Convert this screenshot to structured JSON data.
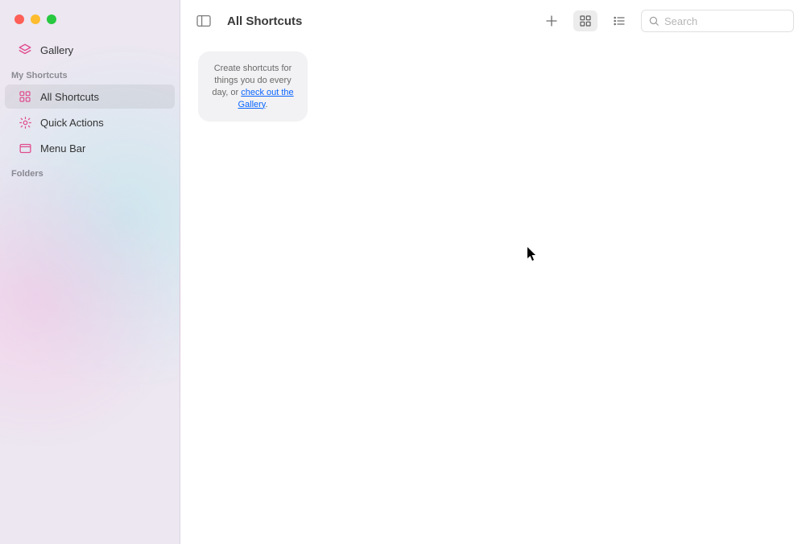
{
  "sidebar": {
    "top": {
      "gallery_label": "Gallery"
    },
    "section_my": "My Shortcuts",
    "items": [
      {
        "label": "All Shortcuts"
      },
      {
        "label": "Quick Actions"
      },
      {
        "label": "Menu Bar"
      }
    ],
    "section_folders": "Folders"
  },
  "header": {
    "title": "All Shortcuts",
    "search_placeholder": "Search"
  },
  "empty": {
    "text_before": "Create shortcuts for things you do every day, or ",
    "link": "check out the Gallery",
    "text_after": "."
  },
  "colors": {
    "gallery_icon": "#e14b8e",
    "all_icon": "#e14b8e",
    "quick_icon": "#e14b8e",
    "menu_icon": "#e14b8e",
    "link": "#0a66ff"
  }
}
